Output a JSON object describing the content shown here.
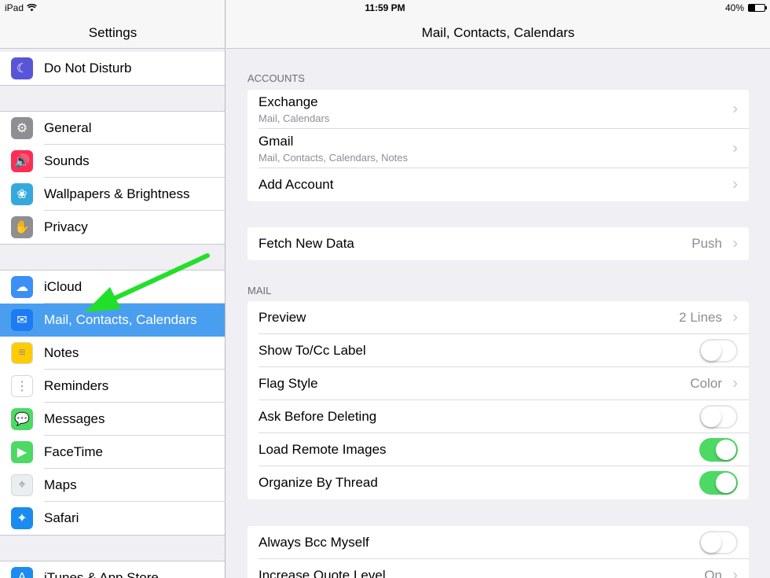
{
  "status_bar": {
    "device": "iPad",
    "time": "11:59 PM",
    "battery_percent": "40%",
    "battery_level": 0.4
  },
  "sidebar": {
    "title": "Settings",
    "items": [
      {
        "label": "Do Not Disturb",
        "icon": "moon-icon",
        "color": "#5856d6"
      },
      {
        "label": "General",
        "icon": "gear-icon",
        "color": "#8e8e93"
      },
      {
        "label": "Sounds",
        "icon": "speaker-icon",
        "color": "#ff2d55"
      },
      {
        "label": "Wallpapers & Brightness",
        "icon": "flower-icon",
        "color": "#34aadc"
      },
      {
        "label": "Privacy",
        "icon": "hand-icon",
        "color": "#8e8e93"
      },
      {
        "label": "iCloud",
        "icon": "cloud-icon",
        "color": "#3b8ff5"
      },
      {
        "label": "Mail, Contacts, Calendars",
        "icon": "envelope-icon",
        "color": "#1e7cf2",
        "selected": true
      },
      {
        "label": "Notes",
        "icon": "notes-icon",
        "color": "#ffcc00"
      },
      {
        "label": "Reminders",
        "icon": "list-icon",
        "color": "#ffffff"
      },
      {
        "label": "Messages",
        "icon": "message-bubble-icon",
        "color": "#4cd964"
      },
      {
        "label": "FaceTime",
        "icon": "video-camera-icon",
        "color": "#4cd964"
      },
      {
        "label": "Maps",
        "icon": "map-icon",
        "color": "#e9eef0"
      },
      {
        "label": "Safari",
        "icon": "compass-icon",
        "color": "#1a8cf0"
      },
      {
        "label": "iTunes & App Store",
        "icon": "app-store-icon",
        "color": "#1a8cf0"
      }
    ]
  },
  "main": {
    "title": "Mail, Contacts, Calendars",
    "accounts_header": "ACCOUNTS",
    "accounts": [
      {
        "title": "Exchange",
        "subtitle": "Mail, Calendars"
      },
      {
        "title": "Gmail",
        "subtitle": "Mail, Contacts, Calendars, Notes"
      },
      {
        "title": "Add Account"
      }
    ],
    "fetch": {
      "title": "Fetch New Data",
      "value": "Push"
    },
    "mail_header": "MAIL",
    "mail": [
      {
        "title": "Preview",
        "value": "2 Lines"
      },
      {
        "title": "Show To/Cc Label",
        "toggle": false
      },
      {
        "title": "Flag Style",
        "value": "Color"
      },
      {
        "title": "Ask Before Deleting",
        "toggle": false
      },
      {
        "title": "Load Remote Images",
        "toggle": true
      },
      {
        "title": "Organize By Thread",
        "toggle": true
      }
    ],
    "more": [
      {
        "title": "Always Bcc Myself",
        "toggle": false
      },
      {
        "title": "Increase Quote Level",
        "value": "On"
      }
    ]
  },
  "colors": {
    "selection": "#4a9ef0",
    "toggle_on": "#4cd964",
    "annotation_arrow": "#22e02a"
  }
}
